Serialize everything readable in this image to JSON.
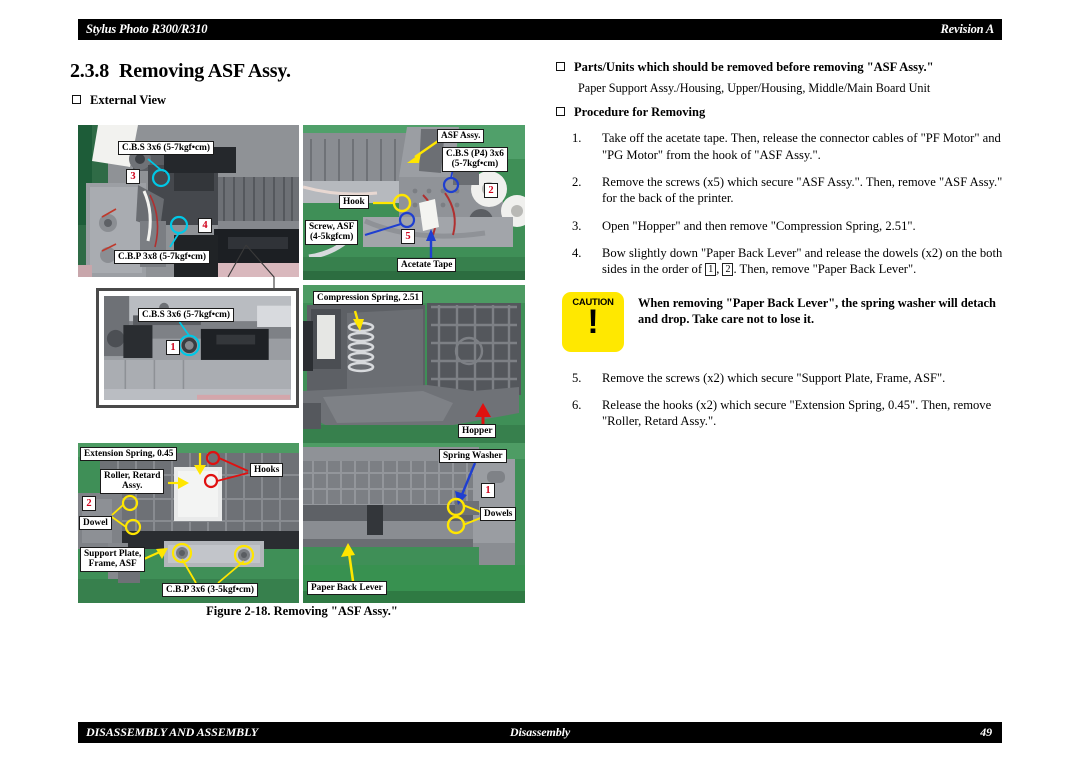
{
  "header": {
    "left": "Stylus Photo R300/R310",
    "right": "Revision A"
  },
  "footer": {
    "left": "DISASSEMBLY AND ASSEMBLY",
    "center": "Disassembly",
    "page": "49"
  },
  "section": {
    "number": "2.3.8",
    "title": "Removing ASF Assy."
  },
  "left_column": {
    "external_view_heading": "External View",
    "figure_caption": "Figure 2-18.  Removing \"ASF Assy.\""
  },
  "right_column": {
    "prereq_heading": "Parts/Units which should be removed before removing \"ASF Assy.\"",
    "prereq_text": "Paper Support Assy./Housing, Upper/Housing, Middle/Main Board Unit",
    "procedure_heading": "Procedure for Removing",
    "steps": [
      {
        "n": "1.",
        "text": "Take off the acetate tape. Then, release the connector cables of \"PF Motor\" and \"PG Motor\" from the hook of \"ASF Assy.\"."
      },
      {
        "n": "2.",
        "text": "Remove the screws (x5) which secure \"ASF Assy.\". Then, remove \"ASF Assy.\" for the back of the printer."
      },
      {
        "n": "3.",
        "text": "Open \"Hopper\" and then remove \"Compression Spring, 2.51\"."
      }
    ],
    "step4": {
      "n": "4.",
      "part1": "Bow slightly down \"Paper Back Lever\" and release the dowels (x2) on the both sides in the order of ",
      "box1": "1",
      "mid": ", ",
      "box2": "2",
      "part2": ". Then, remove \"Paper Back Lever\"."
    },
    "caution": {
      "label": "CAUTION",
      "mark": "!",
      "text": "When removing \"Paper Back Lever\", the spring washer will detach and drop. Take care not to lose it."
    },
    "steps_after": [
      {
        "n": "5.",
        "text": "Remove the screws (x2) which secure \"Support Plate, Frame, ASF\"."
      },
      {
        "n": "6.",
        "text": "Release the hooks (x2) which secure \"Extension Spring, 0.45\". Then, remove \"Roller, Retard Assy.\"."
      }
    ]
  },
  "figure_panels": {
    "top_left": {
      "labels": {
        "screw_cbs": "C.B.S 3x6 (5-7kgf•cm)",
        "screw_cbp": "C.B.P 3x8 (5-7kgf•cm)"
      },
      "markers": {
        "m3": "3",
        "m4": "4"
      }
    },
    "detail_left": {
      "labels": {
        "screw_cbs": "C.B.S 3x6 (5-7kgf•cm)"
      },
      "markers": {
        "m1": "1"
      }
    },
    "top_right": {
      "labels": {
        "asf_assy": "ASF Assy.",
        "screw_cbs_p4": "C.B.S (P4) 3x6\n(5-7kgf•cm)",
        "hook": "Hook",
        "screw_asf": "Screw, ASF\n(4-5kgfcm)",
        "acetate_tape": "Acetate Tape"
      },
      "markers": {
        "m2": "2",
        "m5": "5"
      }
    },
    "middle_right": {
      "labels": {
        "compression_spring": "Compression Spring, 2.51",
        "hopper": "Hopper"
      }
    },
    "bottom_left": {
      "labels": {
        "extension_spring": "Extension Spring, 0.45",
        "roller_retard": "Roller, Retard\nAssy.",
        "hooks": "Hooks",
        "dowel": "Dowel",
        "support_plate": "Support Plate,\nFrame, ASF",
        "screw_cbp": "C.B.P 3x6 (3-5kgf•cm)"
      },
      "markers": {
        "m2": "2"
      }
    },
    "bottom_right": {
      "labels": {
        "spring_washer": "Spring Washer",
        "dowels": "Dowels",
        "paper_back_lever": "Paper Back Lever"
      },
      "markers": {
        "m1": "1"
      }
    }
  },
  "colors": {
    "caution_yellow": "#ffe800",
    "marker_red": "#d0021b",
    "leader_cyan": "#00c8e6",
    "leader_yellow": "#ffe600",
    "leader_blue": "#1f3fd0",
    "leader_red": "#e01010",
    "photo_mat_green": "#3f8f57"
  }
}
